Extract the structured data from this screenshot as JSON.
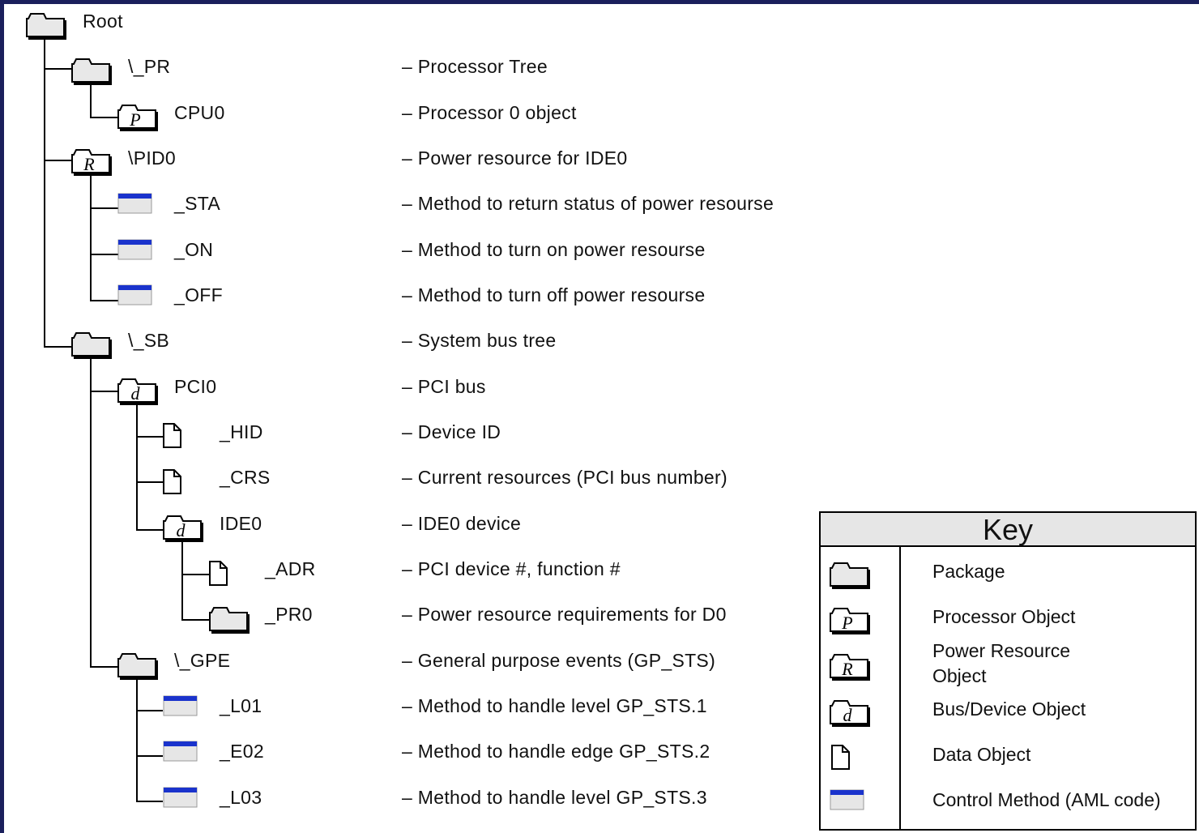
{
  "tree": {
    "root": {
      "label": "Root"
    },
    "pr": {
      "label": "\\_PR",
      "desc": "– Processor Tree"
    },
    "cpu0": {
      "label": "CPU0",
      "desc": "– Processor 0 object"
    },
    "pid0": {
      "label": "\\PID0",
      "desc": "– Power resource for IDE0"
    },
    "sta": {
      "label": "_STA",
      "desc": "– Method to return status of power resourse"
    },
    "on": {
      "label": "_ON",
      "desc": "– Method to turn on power resourse"
    },
    "off": {
      "label": "_OFF",
      "desc": "– Method to turn off power resourse"
    },
    "sb": {
      "label": "\\_SB",
      "desc": "– System bus tree"
    },
    "pci0": {
      "label": "PCI0",
      "desc": "– PCI bus"
    },
    "hid": {
      "label": "_HID",
      "desc": "– Device ID"
    },
    "crs": {
      "label": "_CRS",
      "desc": "– Current resources (PCI bus number)"
    },
    "ide0": {
      "label": "IDE0",
      "desc": "– IDE0 device"
    },
    "adr": {
      "label": "_ADR",
      "desc": "– PCI device #, function #"
    },
    "pr0": {
      "label": "_PR0",
      "desc": "– Power resource requirements for D0"
    },
    "gpe": {
      "label": "\\_GPE",
      "desc": "– General purpose events (GP_STS)"
    },
    "l01": {
      "label": "_L01",
      "desc": "– Method to handle level GP_STS.1"
    },
    "e02": {
      "label": "_E02",
      "desc": "– Method to handle edge GP_STS.2"
    },
    "l03": {
      "label": "_L03",
      "desc": "– Method to handle level GP_STS.3"
    }
  },
  "key": {
    "title": "Key",
    "package": "Package",
    "processor": "Processor Object",
    "power_line1": "Power Resource",
    "power_line2": "Object",
    "bus_device": "Bus/Device Object",
    "data": "Data Object",
    "method": "Control Method (AML code)"
  },
  "icon_letters": {
    "processor": "P",
    "power": "R",
    "device": "d"
  },
  "colors": {
    "background_border": "#1a1f5c",
    "method_bar": "#1a33cc",
    "method_fill": "#e6e6e6",
    "key_header": "#e6e6e6"
  }
}
